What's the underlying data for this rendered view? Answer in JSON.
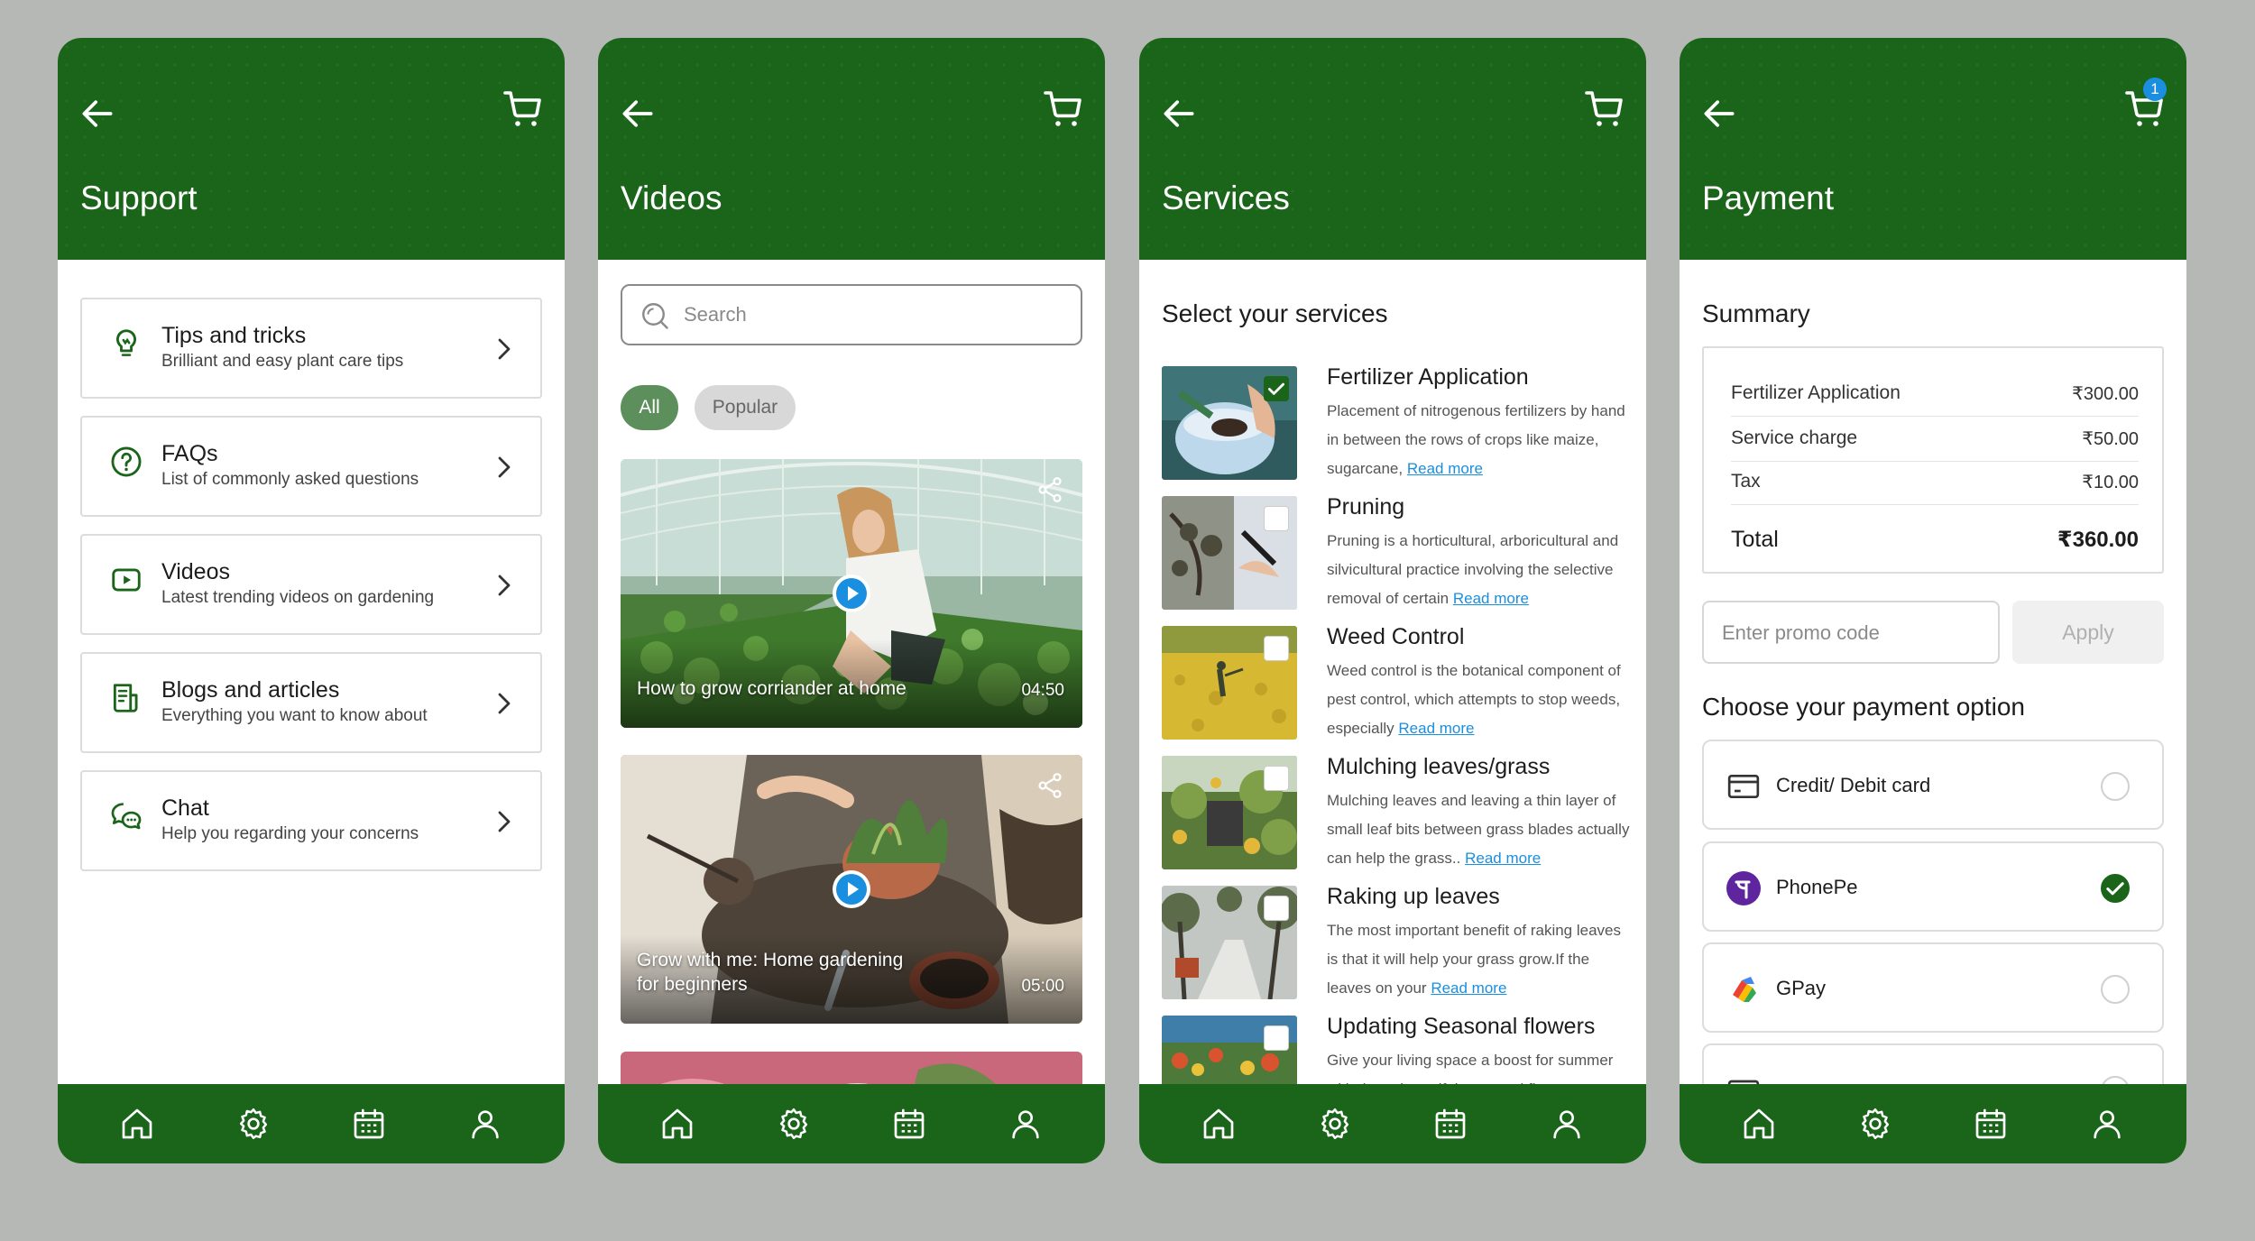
{
  "colors": {
    "primary": "#1a651a",
    "link": "#1a8fe0",
    "badge": "#1a8fe0",
    "background": "#b5b8b5"
  },
  "screens": {
    "support": {
      "title": "Support",
      "items": [
        {
          "title": "Tips and tricks",
          "subtitle": "Brilliant and easy plant care tips",
          "icon": "lightbulb-icon"
        },
        {
          "title": "FAQs",
          "subtitle": "List of commonly asked questions",
          "icon": "question-icon"
        },
        {
          "title": "Videos",
          "subtitle": "Latest trending videos on gardening",
          "icon": "video-icon"
        },
        {
          "title": "Blogs and articles",
          "subtitle": "Everything you want to know about",
          "icon": "article-icon"
        },
        {
          "title": "Chat",
          "subtitle": "Help you regarding your concerns",
          "icon": "chat-icon"
        }
      ]
    },
    "videos": {
      "title": "Videos",
      "search_placeholder": "Search",
      "chips": [
        "All",
        "Popular"
      ],
      "items": [
        {
          "title": "How to grow corriander at home",
          "duration": "04:50"
        },
        {
          "title": "Grow with me: Home gardening for beginners",
          "duration": "05:00"
        }
      ]
    },
    "services": {
      "title": "Services",
      "heading": "Select your services",
      "read_more": "Read more",
      "items": [
        {
          "title": "Fertilizer Application",
          "desc": "Placement of nitrogenous fertilizers by hand in between the rows of crops like maize, sugarcane,",
          "checked": true
        },
        {
          "title": "Pruning",
          "desc": "Pruning is a horticultural, arboricultural and silvicultural practice involving the selective removal of certain",
          "checked": false
        },
        {
          "title": "Weed Control",
          "desc": "Weed control is the botanical component of pest control, which attempts to stop weeds, especially",
          "checked": false
        },
        {
          "title": "Mulching leaves/grass",
          "desc": "Mulching leaves and leaving a thin layer of small leaf bits between grass blades actually can help the grass..",
          "checked": false
        },
        {
          "title": "Raking up leaves",
          "desc": "The most important benefit of raking leaves is that it will help your grass grow.If the leaves on your",
          "checked": false
        },
        {
          "title": "Updating Seasonal flowers",
          "desc": "Give your living space a boost for summer with these beautiful seasonal flowers",
          "checked": false
        }
      ]
    },
    "payment": {
      "title": "Payment",
      "cart_count": "1",
      "summary_title": "Summary",
      "lines": [
        {
          "label": "Fertilizer Application",
          "value": "₹300.00"
        },
        {
          "label": "Service charge",
          "value": "₹50.00"
        },
        {
          "label": "Tax",
          "value": "₹10.00"
        }
      ],
      "total": {
        "label": "Total",
        "value": "₹360.00"
      },
      "promo_placeholder": "Enter promo code",
      "apply_label": "Apply",
      "choose_title": "Choose your payment option",
      "options": [
        {
          "label": "Credit/ Debit card",
          "selected": false,
          "icon": "card-icon"
        },
        {
          "label": "PhonePe",
          "selected": true,
          "icon": "phonepe-icon"
        },
        {
          "label": "GPay",
          "selected": false,
          "icon": "gpay-icon"
        }
      ]
    }
  },
  "bottom_nav": [
    "home-icon",
    "settings-icon",
    "calendar-icon",
    "profile-icon"
  ]
}
